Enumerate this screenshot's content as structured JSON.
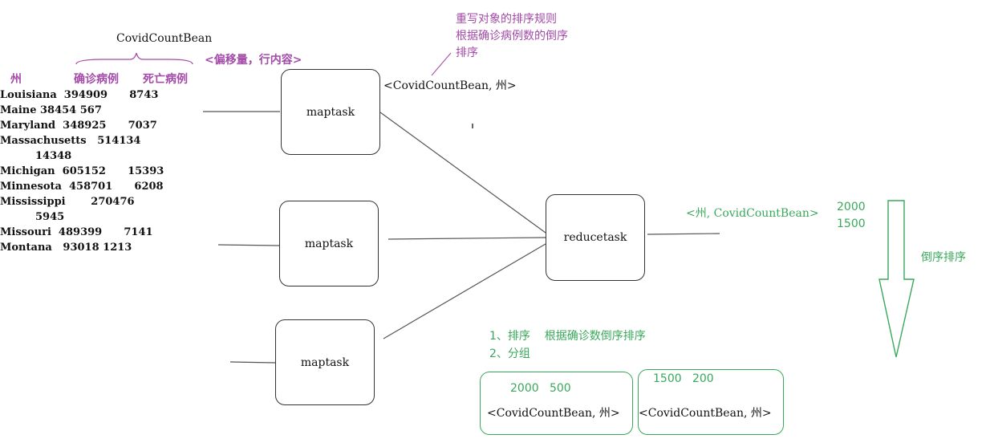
{
  "bean_title": "CovidCountBean",
  "table": {
    "headers": [
      "州",
      "确诊病例",
      "死亡病例"
    ],
    "rows": [
      "Louisiana  394909      8743",
      "Maine 38454 567",
      "Maryland  348925      7037",
      "Massachusetts   514134",
      "14348",
      "Michigan  605152      15393",
      "Minnesota  458701      6208",
      "Mississippi       270476",
      "5945",
      "Missouri  489399      7141",
      "Montana   93018 1213"
    ]
  },
  "input_kv": "<偏移量，行内容>",
  "map_output": "<CovidCountBean, 州>",
  "note": {
    "line1": "重写对象的排序规则",
    "line2": "根据确诊病例数的倒序",
    "line3": "排序"
  },
  "boxes": {
    "map1": "maptask",
    "map2": "maptask",
    "map3": "maptask",
    "reduce": "reducetask"
  },
  "reduce_output": "<州, CovidCountBean>",
  "sorted_values": [
    "2000",
    "1500"
  ],
  "sort_label": "倒序排序",
  "steps": {
    "step1": "1、排序    根据确诊数倒序排序",
    "step2": "2、分组"
  },
  "groups": [
    {
      "numbers": "2000   500",
      "kv": "<CovidCountBean, 州>"
    },
    {
      "numbers": "1500   200",
      "kv": "<CovidCountBean, 州>"
    }
  ],
  "colors": {
    "purple": "#a34aa8",
    "green": "#3aa85a"
  }
}
